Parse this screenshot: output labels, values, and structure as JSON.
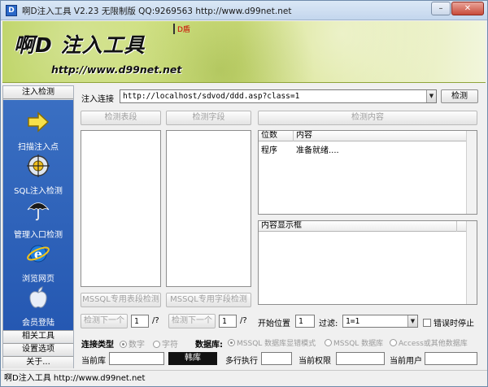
{
  "window": {
    "title": "啊D注入工具 V2.23 无限制版 QQ:9269563 http://www.d99net.net",
    "icon_letter": "D",
    "min_label": "–",
    "close_label": "✕"
  },
  "banner": {
    "brand": "啊D 注入工具",
    "url": "http://www.d99net.net",
    "tag": "D盾"
  },
  "sidebar": {
    "header": "注入检测",
    "items": [
      {
        "label": "扫描注入点",
        "icon": "arrow-right-icon"
      },
      {
        "label": "SQL注入检测",
        "icon": "crosshair-icon"
      },
      {
        "label": "管理入口检测",
        "icon": "umbrella-icon"
      },
      {
        "label": "浏览网页",
        "icon": "ie-icon"
      },
      {
        "label": "会员登陆",
        "icon": "apple-icon"
      }
    ],
    "footer": [
      "相关工具",
      "设置选项",
      "关于..."
    ]
  },
  "inject": {
    "label": "注入连接",
    "url": "http://localhost/sdvod/ddd.asp?class=1",
    "check_button": "检测"
  },
  "panels": {
    "tables_button": "检测表段",
    "fields_button": "检测字段",
    "content_button": "检测内容",
    "mssql_tables_button": "MSSQL专用表段检测",
    "mssql_fields_button": "MSSQL专用字段检测"
  },
  "result_grid": {
    "columns": [
      "位数",
      "内容"
    ],
    "rows": [
      [
        "程序",
        "准备就绪...."
      ]
    ]
  },
  "display_grid": {
    "columns": [
      "内容显示框"
    ]
  },
  "paging": {
    "next_tables": "检测下一个",
    "next_tables_value": "1",
    "next_tables_total": "/?",
    "next_fields": "检测下一个",
    "next_fields_value": "1",
    "next_fields_total": "/?",
    "start_label": "开始位置",
    "start_value": "1",
    "filter_label": "过滤:",
    "filter_value": "1=1",
    "stop_on_error": "错误时停止"
  },
  "conn_type": {
    "label": "连接类型",
    "options": [
      "数字",
      "字符"
    ]
  },
  "database": {
    "label": "数据库:",
    "options": [
      "MSSQL 数据库显错模式",
      "MSSQL 数据库",
      "Access或其他数据库"
    ]
  },
  "info": {
    "current_db": "当前库",
    "role_badge": "韩库",
    "multi_exec": "多行执行",
    "current_priv": "当前权限",
    "current_user": "当前用户"
  },
  "statusbar": {
    "text": "啊D注入工具 http://www.d99net.net"
  },
  "colors": {
    "accent": "#2558b2",
    "banner": "#c9dc6c",
    "tag": "#cc0000"
  }
}
